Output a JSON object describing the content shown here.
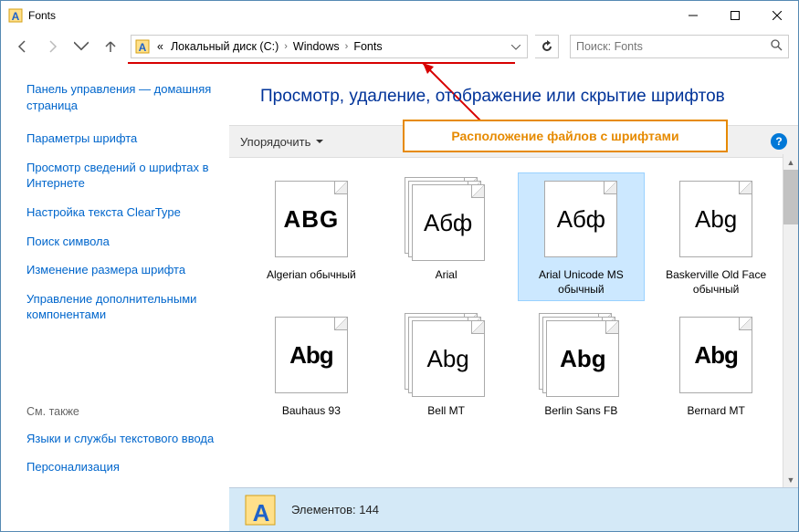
{
  "window": {
    "title": "Fonts"
  },
  "breadcrumb": {
    "prefix": "«",
    "items": [
      "Локальный диск (C:)",
      "Windows",
      "Fonts"
    ]
  },
  "search": {
    "placeholder": "Поиск: Fonts"
  },
  "sidebar": {
    "panel_header": "Панель управления — домашняя страница",
    "links": [
      "Параметры шрифта",
      "Просмотр сведений о шрифтах в Интернете",
      "Настройка текста ClearType",
      "Поиск символа",
      "Изменение размера шрифта",
      "Управление дополнительными компонентами"
    ],
    "see_also_label": "См. также",
    "see_also_links": [
      "Языки и службы текстового ввода",
      "Персонализация"
    ]
  },
  "main": {
    "header": "Просмотр, удаление, отображение или скрытие шрифтов",
    "organize_label": "Упорядочить",
    "callout": "Расположение файлов с шрифтами"
  },
  "fonts": [
    {
      "preview": "ABG",
      "label": "Algerian обычный",
      "class": "f-algerian",
      "stack": false
    },
    {
      "preview": "Абф",
      "label": "Arial",
      "class": "f-arial",
      "stack": true
    },
    {
      "preview": "Абф",
      "label": "Arial Unicode MS обычный",
      "class": "f-arial",
      "stack": false,
      "selected": true
    },
    {
      "preview": "Abg",
      "label": "Baskerville Old Face обычный",
      "class": "f-baskerville",
      "stack": false
    },
    {
      "preview": "Abg",
      "label": "Bauhaus 93",
      "class": "f-bauhaus",
      "stack": false
    },
    {
      "preview": "Abg",
      "label": "Bell MT",
      "class": "f-bell",
      "stack": true
    },
    {
      "preview": "Abg",
      "label": "Berlin Sans FB",
      "class": "f-berlin",
      "stack": true
    },
    {
      "preview": "Abg",
      "label": "Bernard MT",
      "class": "f-bernard",
      "stack": false
    }
  ],
  "status": {
    "count_label": "Элементов: 144"
  }
}
